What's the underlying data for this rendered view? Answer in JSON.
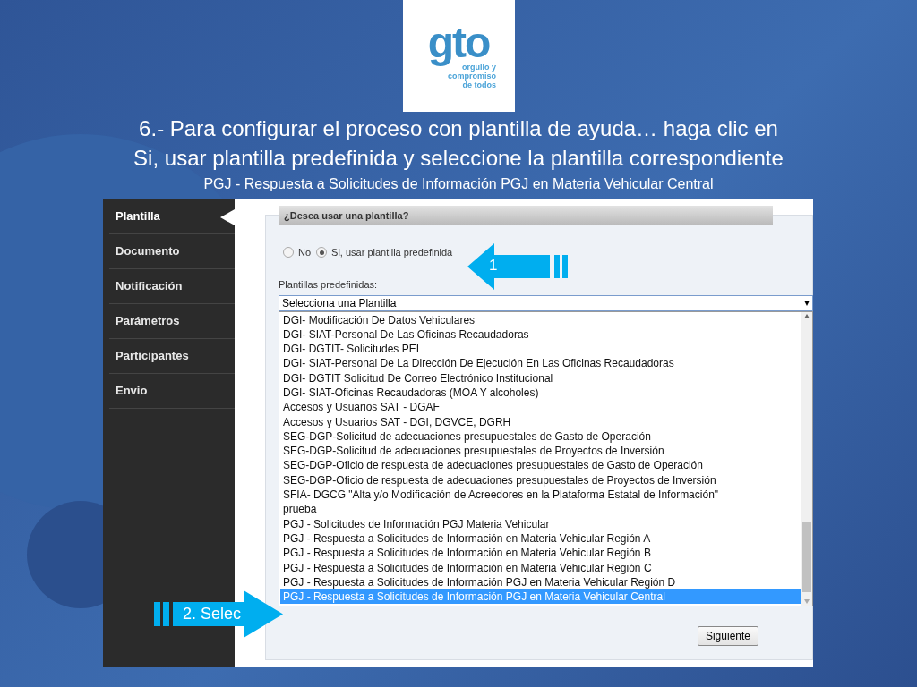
{
  "logo": {
    "mark": "gto",
    "tagline": [
      "orgullo y",
      "compromiso",
      "de todos"
    ]
  },
  "slide": {
    "title_lines": [
      "6.- Para configurar el proceso con plantilla de ayuda… haga clic en",
      "Si, usar plantilla predefinida y seleccione la plantilla correspondiente"
    ],
    "subtitle": "PGJ - Respuesta a Solicitudes de Información PGJ en Materia Vehicular Central"
  },
  "sidebar": {
    "items": [
      {
        "label": "Plantilla",
        "selected": true
      },
      {
        "label": "Documento",
        "selected": false
      },
      {
        "label": "Notificación",
        "selected": false
      },
      {
        "label": "Parámetros",
        "selected": false
      },
      {
        "label": "Participantes",
        "selected": false
      },
      {
        "label": "Envio",
        "selected": false
      }
    ]
  },
  "form": {
    "question": "¿Desea usar una plantilla?",
    "radios": [
      {
        "label": "No",
        "selected": false
      },
      {
        "label": "Si, usar plantilla predefinida",
        "selected": true
      }
    ],
    "templates_label": "Plantillas predefinidas:",
    "select_value": "Selecciona una Plantilla",
    "options": [
      {
        "label": "DGI- Modificación De Datos Vehiculares",
        "selected": false
      },
      {
        "label": "DGI- SIAT-Personal De Las Oficinas Recaudadoras",
        "selected": false
      },
      {
        "label": "DGI- DGTIT- Solicitudes PEI",
        "selected": false
      },
      {
        "label": "DGI- SIAT-Personal De La Dirección De Ejecución En Las Oficinas Recaudadoras",
        "selected": false
      },
      {
        "label": "DGI- DGTIT Solicitud De Correo Electrónico Institucional",
        "selected": false
      },
      {
        "label": "DGI- SIAT-Oficinas Recaudadoras (MOA Y alcoholes)",
        "selected": false
      },
      {
        "label": "Accesos y Usuarios SAT - DGAF",
        "selected": false
      },
      {
        "label": "Accesos y Usuarios SAT - DGI, DGVCE, DGRH",
        "selected": false
      },
      {
        "label": "SEG-DGP-Solicitud de adecuaciones presupuestales de Gasto de Operación",
        "selected": false
      },
      {
        "label": "SEG-DGP-Solicitud de adecuaciones presupuestales de Proyectos de Inversión",
        "selected": false
      },
      {
        "label": "SEG-DGP-Oficio de respuesta de adecuaciones presupuestales de Gasto de Operación",
        "selected": false
      },
      {
        "label": "SEG-DGP-Oficio de respuesta de adecuaciones presupuestales de Proyectos de Inversión",
        "selected": false
      },
      {
        "label": "SFIA- DGCG \"Alta y/o Modificación de Acreedores en la Plataforma Estatal de Información\"",
        "selected": false
      },
      {
        "label": "prueba",
        "selected": false
      },
      {
        "label": "PGJ - Solicitudes de Información PGJ Materia Vehicular",
        "selected": false
      },
      {
        "label": "PGJ - Respuesta a Solicitudes de Información en Materia Vehicular Región A",
        "selected": false
      },
      {
        "label": "PGJ - Respuesta a Solicitudes de Información en Materia Vehicular Región B",
        "selected": false
      },
      {
        "label": "PGJ - Respuesta a Solicitudes de Información en Materia Vehicular Región C",
        "selected": false
      },
      {
        "label": "PGJ - Respuesta a Solicitudes de Información PGJ en Materia Vehicular Región D",
        "selected": false
      },
      {
        "label": "PGJ - Respuesta a Solicitudes de Información PGJ en Materia Vehicular Central",
        "selected": true
      }
    ],
    "next_button": "Siguiente"
  },
  "callouts": [
    {
      "kind": "left",
      "label": "1"
    },
    {
      "kind": "right",
      "label": "2. Selec"
    }
  ]
}
